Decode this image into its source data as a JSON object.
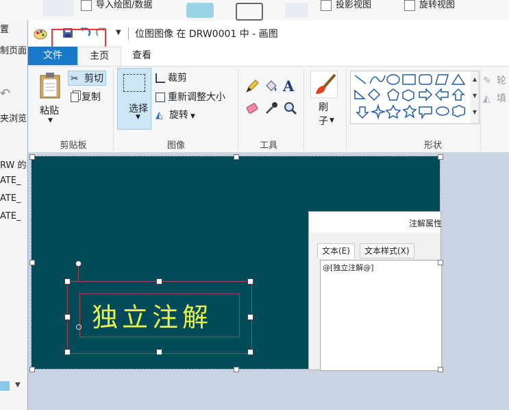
{
  "background_app": {
    "toolbar_items": [
      {
        "label": "导入绘图/数据"
      },
      {
        "label": "投影视图"
      },
      {
        "label": "旋转视图"
      }
    ],
    "left_panel_fragments": [
      "置",
      "制页面",
      "夹浏览",
      "RW 的",
      "ATE_",
      "ATE_",
      "ATE_"
    ]
  },
  "paint": {
    "title": "位图图像 在 DRW0001 中 - 画图",
    "tabs": [
      "文件",
      "主页",
      "查看"
    ],
    "groups": {
      "clipboard": {
        "label": "剪贴板",
        "paste": "粘贴",
        "cut": "剪切",
        "copy": "复制"
      },
      "image": {
        "label": "图像",
        "select": "选择",
        "crop": "裁剪",
        "resize": "重新调整大小",
        "rotate": "旋转"
      },
      "tools": {
        "label": "工具"
      },
      "brush": {
        "label": "刷子"
      },
      "shapes": {
        "label": "形状",
        "outline": "轮",
        "fill": "填"
      }
    }
  },
  "canvas_image": {
    "note_text": "独立注解",
    "dialog": {
      "title": "注解属性",
      "tab_text": "文本(E)",
      "tab_style": "文本样式(X)",
      "content": "@[独立注解@]"
    }
  },
  "colors": {
    "file_tab": "#1979ca",
    "canvas_bg": "#044b5a",
    "note_text": "#e8f04a",
    "highlight_box": "#e23a3a"
  }
}
